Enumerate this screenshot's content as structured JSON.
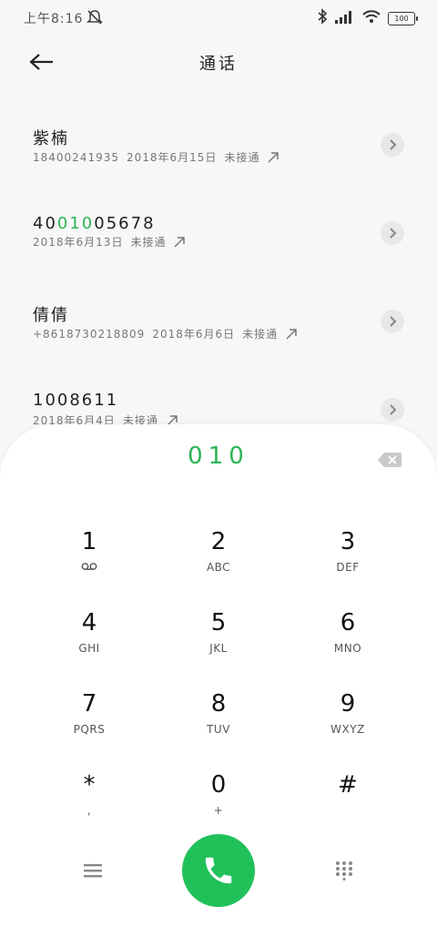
{
  "status_bar": {
    "time": "上午8:16",
    "battery": "100"
  },
  "header": {
    "title": "通话"
  },
  "recent_calls": [
    {
      "name": "紫楠",
      "number": "18400241935",
      "date": "2018年6月15日",
      "status": "未接通"
    },
    {
      "name_prefix": "40",
      "name_highlight": "010",
      "name_suffix": "05678",
      "number": "",
      "date": "2018年6月13日",
      "status": "未接通"
    },
    {
      "name": "倩倩",
      "number": "+8618730218809",
      "date": "2018年6月6日",
      "status": "未接通"
    },
    {
      "name": "1008611",
      "number": "",
      "date": "2018年6月4日",
      "status": "未接通"
    }
  ],
  "dialer": {
    "typed_number": "010",
    "keys": [
      {
        "digit": "1",
        "letters": ""
      },
      {
        "digit": "2",
        "letters": "ABC"
      },
      {
        "digit": "3",
        "letters": "DEF"
      },
      {
        "digit": "4",
        "letters": "GHI"
      },
      {
        "digit": "5",
        "letters": "JKL"
      },
      {
        "digit": "6",
        "letters": "MNO"
      },
      {
        "digit": "7",
        "letters": "PQRS"
      },
      {
        "digit": "8",
        "letters": "TUV"
      },
      {
        "digit": "9",
        "letters": "WXYZ"
      },
      {
        "digit": "*",
        "letters": ","
      },
      {
        "digit": "0",
        "letters": "+"
      },
      {
        "digit": "#",
        "letters": ""
      }
    ]
  },
  "colors": {
    "accent": "#2bb557",
    "call_button": "#21c15a"
  },
  "icons": [
    "mute-icon",
    "bluetooth-icon",
    "signal-icon",
    "wifi-icon",
    "battery-icon",
    "back-arrow-icon",
    "chevron-right-icon",
    "outgoing-call-icon",
    "backspace-icon",
    "voicemail-icon",
    "menu-icon",
    "phone-icon",
    "keypad-icon"
  ]
}
